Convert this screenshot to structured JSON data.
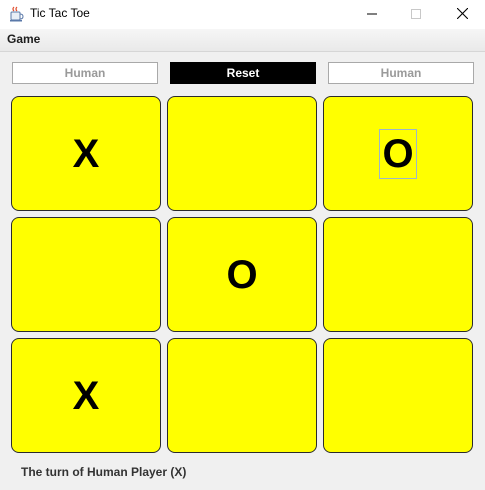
{
  "window": {
    "title": "Tic Tac Toe"
  },
  "menu": {
    "game_label": "Game"
  },
  "toolbar": {
    "player_x_label": "Human",
    "reset_label": "Reset",
    "player_o_label": "Human"
  },
  "board": {
    "cells": [
      "X",
      "",
      "O",
      "",
      "O",
      "",
      "X",
      "",
      ""
    ],
    "focused_cell": 2
  },
  "colors": {
    "cell_background": "#ffff00",
    "reset_background": "#000000",
    "window_background": "#f0f0f0"
  },
  "icons": {
    "app": "java-cup-icon",
    "minimize": "minimize-icon",
    "maximize": "maximize-icon",
    "close": "close-icon"
  },
  "status": {
    "text": "The turn of Human Player (X)"
  }
}
